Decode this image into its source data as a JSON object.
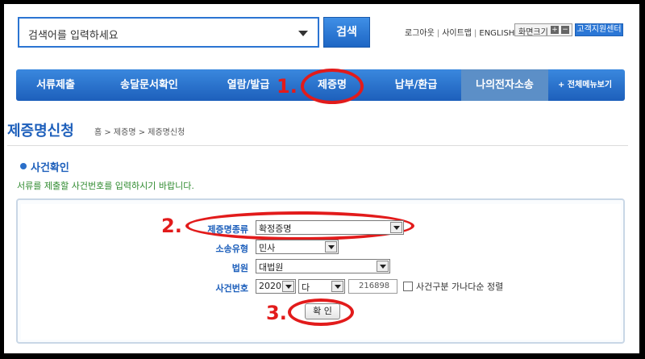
{
  "search": {
    "placeholder": "검색어를 입력하세요",
    "button_label": "검색"
  },
  "util": {
    "logout": "로그아웃",
    "sitemap": "사이트맵",
    "english": "ENGLISH",
    "zoom_label": "화면크기",
    "zoom_plus": "+",
    "zoom_minus": "−",
    "support": "고객지원센터"
  },
  "nav": {
    "items": [
      "서류제출",
      "송달문서확인",
      "열람/발급",
      "제증명",
      "납부/환급",
      "나의전자소송"
    ],
    "all_menu": "+ 전체메뉴보기"
  },
  "steps": {
    "one": "1.",
    "two": "2.",
    "three": "3."
  },
  "page": {
    "title": "제증명신청",
    "breadcrumb": "홈 > 제증명 > 제증명신청"
  },
  "section": {
    "title": "사건확인",
    "desc": "서류를 제출할 사건번호를 입력하시기 바랍니다."
  },
  "form": {
    "cert_type_label": "제증명종류",
    "cert_type_value": "확정증명",
    "lawsuit_type_label": "소송유형",
    "lawsuit_type_value": "민사",
    "court_label": "법원",
    "court_value": "대법원",
    "case_no_label": "사건번호",
    "year_value": "2020",
    "case_code_value": "다",
    "case_number_value": "216898",
    "sort_checkbox_label": "사건구분 가나다순 정렬",
    "confirm_label": "확 인"
  },
  "colors": {
    "accent": "#1d5fbb",
    "highlight": "#e21b1b",
    "desc_green": "#2e8a2e"
  }
}
